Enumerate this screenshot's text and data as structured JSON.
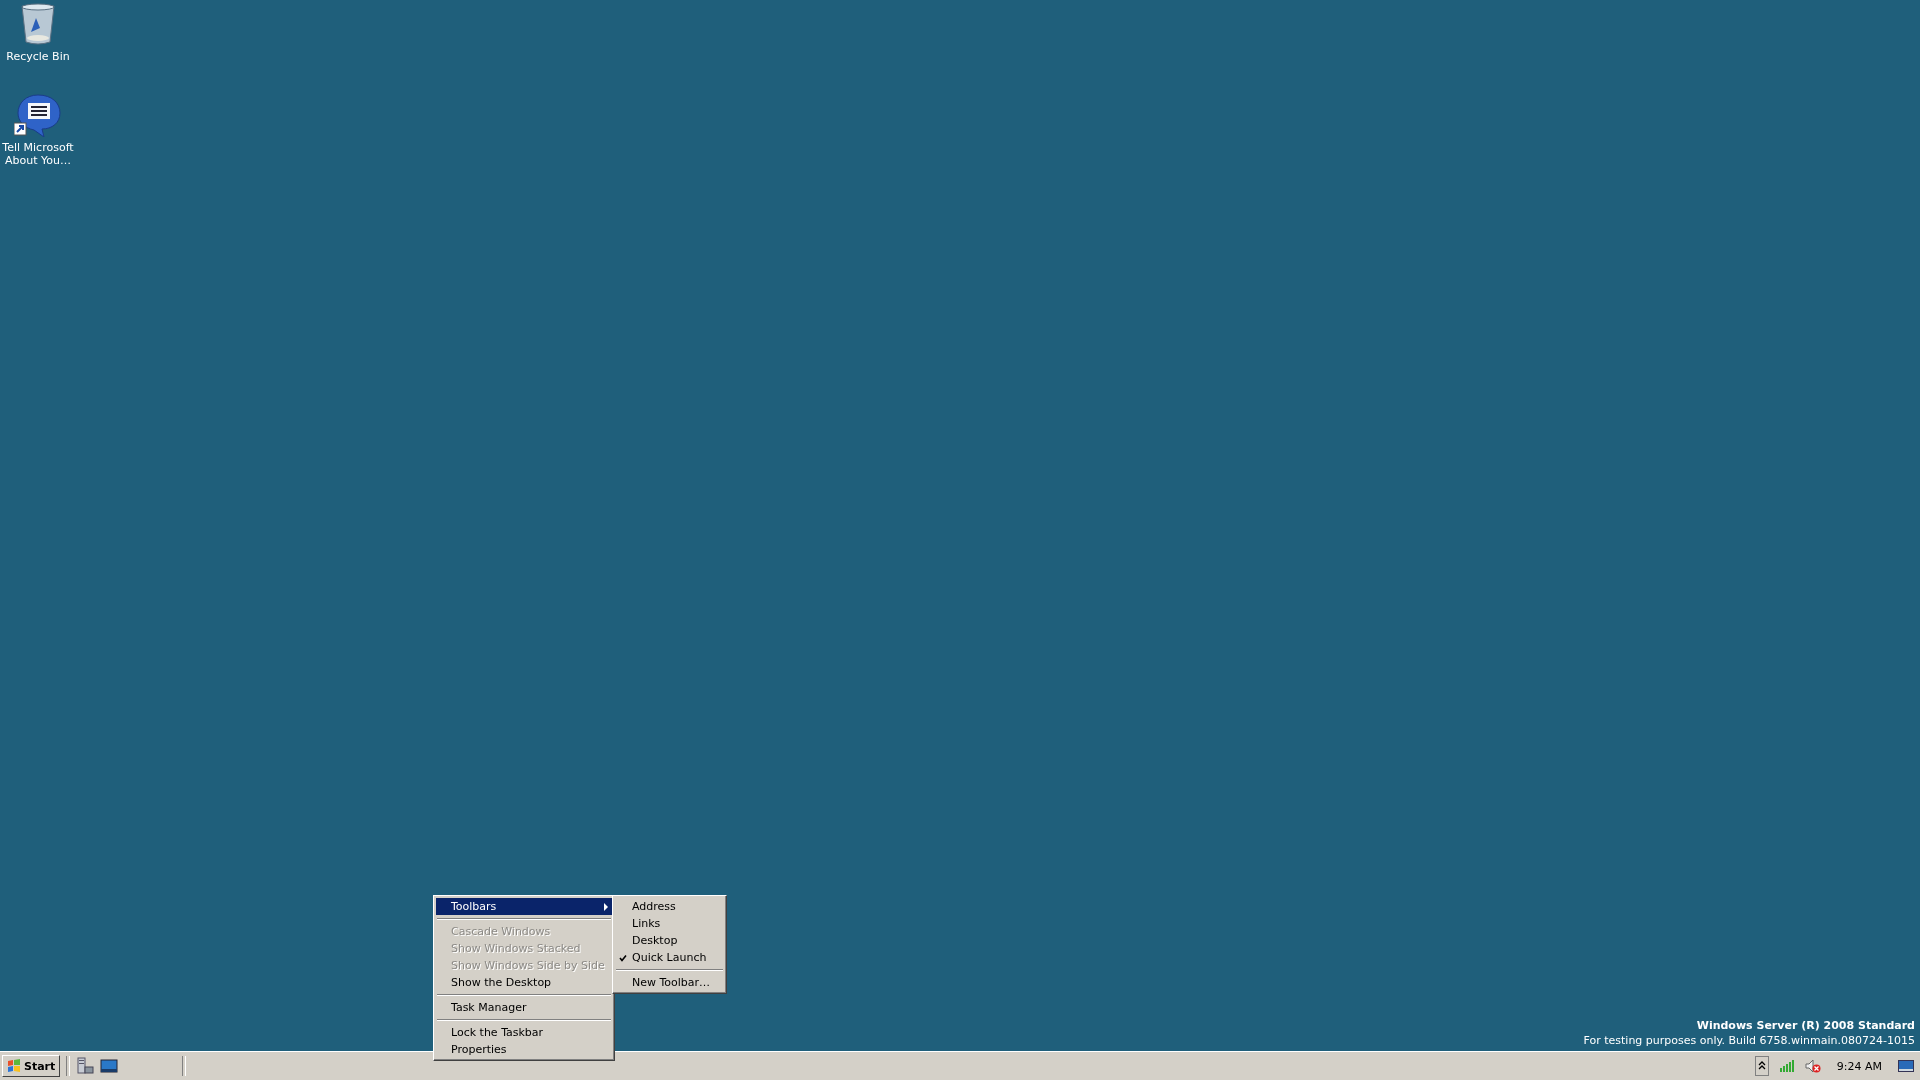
{
  "desktop_icons": [
    {
      "label": "Recycle Bin",
      "kind": "bin"
    },
    {
      "label": "Tell Microsoft About You…",
      "kind": "feedback"
    }
  ],
  "context_menu": {
    "items": [
      {
        "kind": "item",
        "label": "Toolbars",
        "selected": true,
        "disabled": false,
        "submenu": true
      },
      {
        "kind": "separator"
      },
      {
        "kind": "item",
        "label": "Cascade Windows",
        "selected": false,
        "disabled": true,
        "submenu": false
      },
      {
        "kind": "item",
        "label": "Show Windows Stacked",
        "selected": false,
        "disabled": true,
        "submenu": false
      },
      {
        "kind": "item",
        "label": "Show Windows Side by Side",
        "selected": false,
        "disabled": true,
        "submenu": false
      },
      {
        "kind": "item",
        "label": "Show the Desktop",
        "selected": false,
        "disabled": false,
        "submenu": false
      },
      {
        "kind": "separator"
      },
      {
        "kind": "item",
        "label": "Task Manager",
        "selected": false,
        "disabled": false,
        "submenu": false
      },
      {
        "kind": "separator"
      },
      {
        "kind": "item",
        "label": "Lock the Taskbar",
        "selected": false,
        "disabled": false,
        "submenu": false
      },
      {
        "kind": "item",
        "label": "Properties",
        "selected": false,
        "disabled": false,
        "submenu": false
      }
    ]
  },
  "submenu": {
    "items": [
      {
        "kind": "item",
        "label": "Address",
        "checked": false
      },
      {
        "kind": "item",
        "label": "Links",
        "checked": false
      },
      {
        "kind": "item",
        "label": "Desktop",
        "checked": false
      },
      {
        "kind": "item",
        "label": "Quick Launch",
        "checked": true
      },
      {
        "kind": "separator"
      },
      {
        "kind": "item",
        "label": "New Toolbar…",
        "checked": false
      }
    ]
  },
  "branding": {
    "edition": "Windows Server (R) 2008 Standard",
    "build": "For testing purposes only. Build 6758.winmain.080724-1015"
  },
  "taskbar": {
    "start": "Start",
    "quick_launch": [
      {
        "kind": "server"
      },
      {
        "kind": "desktop"
      }
    ],
    "clock": "9:24 AM"
  }
}
